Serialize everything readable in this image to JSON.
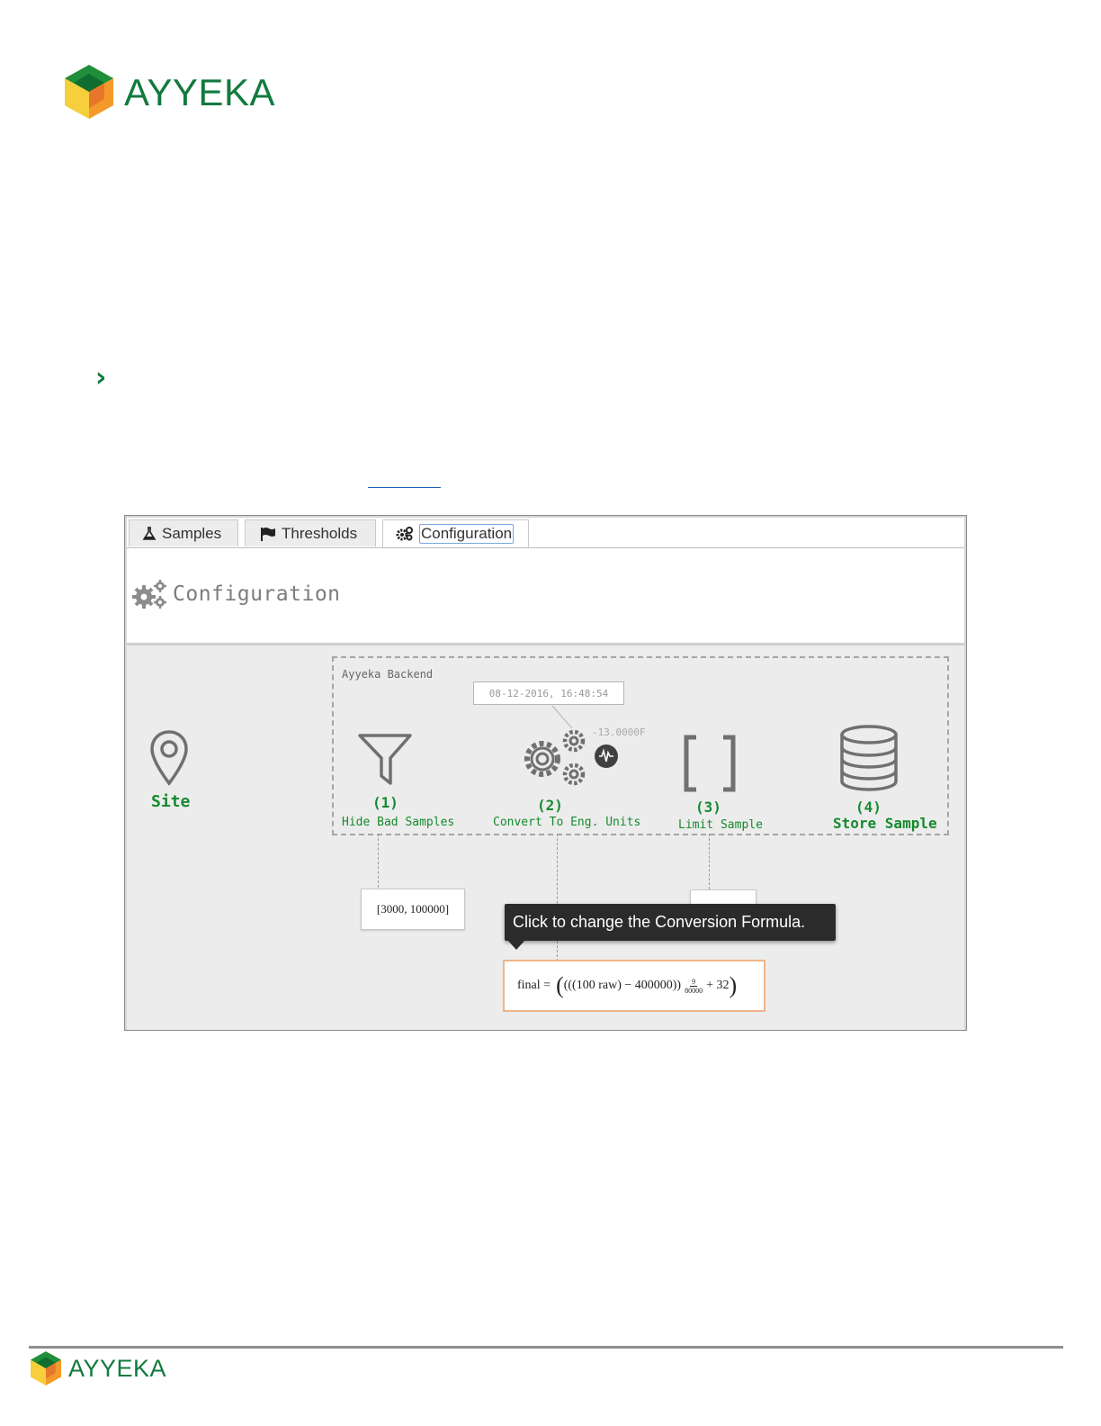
{
  "header": {
    "logo_text": "AYYEKA"
  },
  "footer": {
    "logo_text": "AYYEKA"
  },
  "bullet": {
    "chevron": "›"
  },
  "tabs": [
    {
      "label": "Samples",
      "icon": "flask-icon"
    },
    {
      "label": "Thresholds",
      "icon": "flag-icon"
    },
    {
      "label": "Configuration",
      "icon": "gears-icon"
    }
  ],
  "config": {
    "title": "Configuration",
    "site_label": "Site",
    "backend_label": "Ayyeka Backend",
    "timestamp": "08-12-2016, 16:48:54",
    "reading": "-13.0000F",
    "steps": [
      {
        "num": "(1)",
        "label": "Hide Bad Samples"
      },
      {
        "num": "(2)",
        "label": "Convert To Eng. Units"
      },
      {
        "num": "(3)",
        "label": "Limit Sample"
      },
      {
        "num": "(4)",
        "label": "Store Sample"
      }
    ],
    "range_box": "[3000, 100000]",
    "tooltip": "Click to change the Conversion Formula.",
    "formula": {
      "lhs": "final =",
      "body": "(((100 raw) − 400000))",
      "frac_num": "9",
      "frac_den": "80000",
      "tail": "+ 32"
    }
  },
  "colors": {
    "brand_green": "#127a3f",
    "step_green": "#168a2e",
    "tooltip_bg": "#2b2b2b",
    "formula_border": "#f0b58a"
  }
}
